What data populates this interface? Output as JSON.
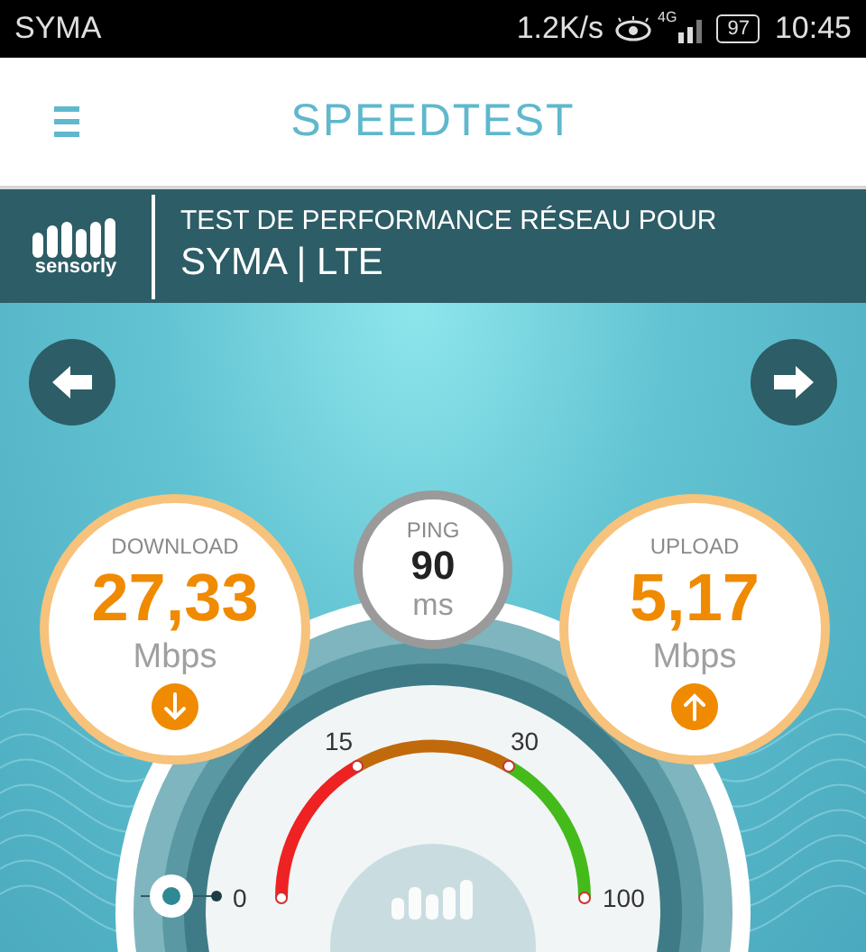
{
  "status_bar": {
    "carrier": "SYMA",
    "speed": "1.2K/s",
    "network": "4G",
    "battery": "97",
    "time": "10:45"
  },
  "header": {
    "title": "SPEEDTEST"
  },
  "banner": {
    "brand": "sensorly",
    "subtitle": "TEST DE PERFORMANCE RÉSEAU POUR",
    "network": "SYMA | LTE"
  },
  "results": [
    {
      "kind": "download",
      "label": "DOWNLOAD",
      "value": "27,33",
      "unit": "Mbps"
    },
    {
      "kind": "ping",
      "label": "PING",
      "value": "90",
      "unit": "ms"
    },
    {
      "kind": "upload",
      "label": "UPLOAD",
      "value": "5,17",
      "unit": "Mbps"
    }
  ],
  "gauge": {
    "ticks": [
      "0",
      "15",
      "30",
      "100"
    ]
  }
}
